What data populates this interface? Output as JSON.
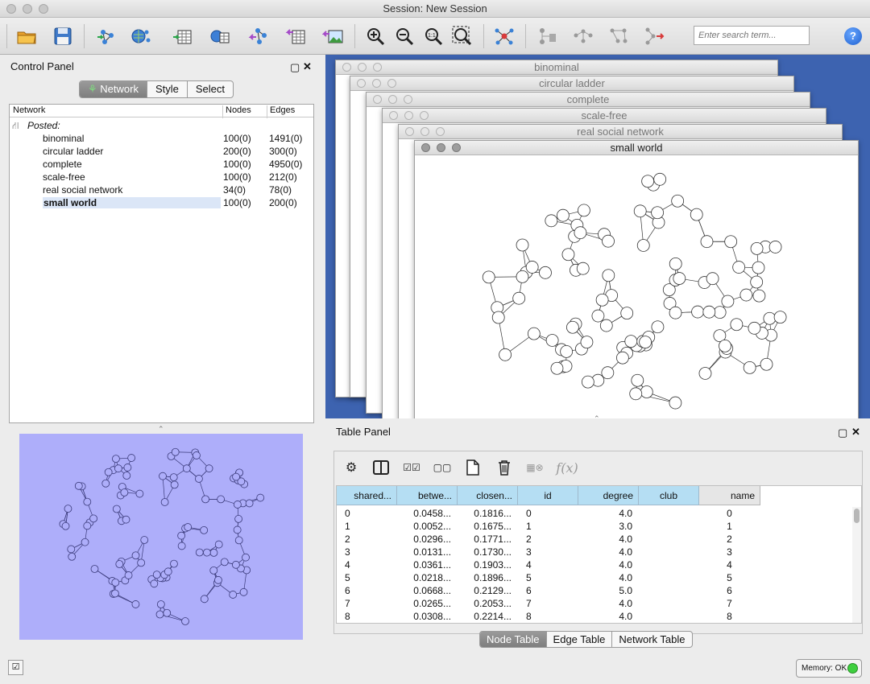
{
  "window": {
    "title": "Session: New Session"
  },
  "toolbar": {
    "icons": [
      "open-session-icon",
      "save-session-icon",
      "import-network-file-icon",
      "import-network-url-icon",
      "import-table-file-icon",
      "import-table-url-icon",
      "export-network-icon",
      "export-table-icon",
      "export-image-icon",
      "zoom-in-icon",
      "zoom-out-icon",
      "zoom-actual-icon",
      "zoom-fit-icon",
      "network-from-selection-icon",
      "apply-layout-icon",
      "layout-icon",
      "layout-2-icon",
      "layout-3-icon"
    ],
    "search_placeholder": "Enter search term..."
  },
  "control_panel": {
    "title": "Control Panel",
    "tabs": [
      "Network",
      "Style",
      "Select"
    ],
    "active_tab": "Network",
    "columns": {
      "network": "Network",
      "nodes": "Nodes",
      "edges": "Edges"
    },
    "group": "Posted:",
    "networks": [
      {
        "name": "binominal",
        "nodes": "100(0)",
        "edges": "1491(0)"
      },
      {
        "name": "circular ladder",
        "nodes": "200(0)",
        "edges": "300(0)"
      },
      {
        "name": "complete",
        "nodes": "100(0)",
        "edges": "4950(0)"
      },
      {
        "name": "scale-free",
        "nodes": "100(0)",
        "edges": "212(0)"
      },
      {
        "name": "real social network",
        "nodes": "34(0)",
        "edges": "78(0)"
      },
      {
        "name": "small world",
        "nodes": "100(0)",
        "edges": "200(0)"
      }
    ],
    "selected_network": "small world"
  },
  "network_windows": [
    "binominal",
    "circular ladder",
    "complete",
    "scale-free",
    "real social network",
    "small world"
  ],
  "table_panel": {
    "title": "Table Panel",
    "tools": [
      "gear-icon",
      "columns-icon",
      "select-all-icon",
      "deselect-all-icon",
      "new-column-icon",
      "delete-icon",
      "link-table-icon",
      "function-builder-icon"
    ],
    "function_label": "f(x)",
    "columns": [
      "shared...",
      "betwe...",
      "closen...",
      "id",
      "degree",
      "club",
      "name"
    ],
    "rows": [
      [
        "0",
        "0.0458...",
        "0.1816...",
        "0",
        "4.0",
        "",
        "0"
      ],
      [
        "1",
        "0.0052...",
        "0.1675...",
        "1",
        "3.0",
        "",
        "1"
      ],
      [
        "2",
        "0.0296...",
        "0.1771...",
        "2",
        "4.0",
        "",
        "2"
      ],
      [
        "3",
        "0.0131...",
        "0.1730...",
        "3",
        "4.0",
        "",
        "3"
      ],
      [
        "4",
        "0.0361...",
        "0.1903...",
        "4",
        "4.0",
        "",
        "4"
      ],
      [
        "5",
        "0.0218...",
        "0.1896...",
        "5",
        "4.0",
        "",
        "5"
      ],
      [
        "6",
        "0.0668...",
        "0.2129...",
        "6",
        "5.0",
        "",
        "6"
      ],
      [
        "7",
        "0.0265...",
        "0.2053...",
        "7",
        "4.0",
        "",
        "7"
      ],
      [
        "8",
        "0.0308...",
        "0.2214...",
        "8",
        "4.0",
        "",
        "8"
      ]
    ],
    "bottom_tabs": [
      "Node Table",
      "Edge Table",
      "Network Table"
    ],
    "active_bottom_tab": "Node Table"
  },
  "status": {
    "memory": "Memory: OK",
    "memory_color": "#3fcf3f"
  },
  "colors": {
    "thumbnail_bg": "#aeaefa",
    "desktop_bg": "#3d63b0",
    "header_blue": "#b5def3",
    "selection": "#dbe6f7"
  }
}
